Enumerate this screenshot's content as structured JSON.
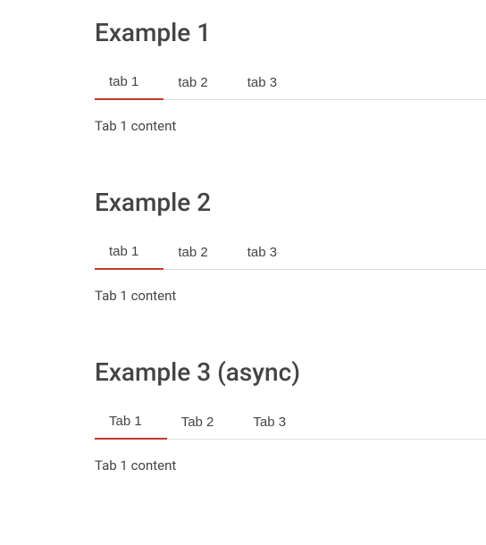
{
  "examples": [
    {
      "heading": "Example 1",
      "tabs": [
        "tab 1",
        "tab 2",
        "tab 3"
      ],
      "activeIndex": 0,
      "content": "Tab 1 content"
    },
    {
      "heading": "Example 2",
      "tabs": [
        "tab 1",
        "tab 2",
        "tab 3"
      ],
      "activeIndex": 0,
      "content": "Tab 1 content"
    },
    {
      "heading": "Example 3 (async)",
      "tabs": [
        "Tab 1",
        "Tab 2",
        "Tab 3"
      ],
      "activeIndex": 0,
      "content": "Tab 1 content"
    }
  ]
}
